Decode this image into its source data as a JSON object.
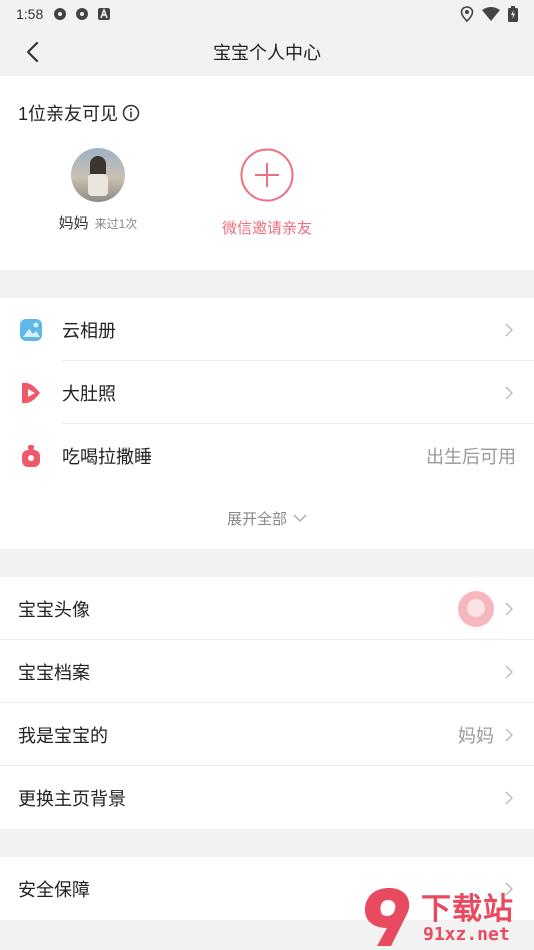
{
  "status_bar": {
    "time": "1:58"
  },
  "nav": {
    "title": "宝宝个人中心"
  },
  "visible": {
    "title": "1位亲友可见",
    "member": {
      "name": "妈妈",
      "visit": "来过1次"
    },
    "invite_label": "微信邀请亲友"
  },
  "features": {
    "items": [
      {
        "label": "云相册",
        "icon": "photo-album-icon"
      },
      {
        "label": "大肚照",
        "icon": "video-play-icon"
      },
      {
        "label": "吃喝拉撒睡",
        "icon": "baby-bottle-icon",
        "value": "出生后可用"
      }
    ],
    "expand_label": "展开全部"
  },
  "settings": {
    "items": [
      {
        "label": "宝宝头像"
      },
      {
        "label": "宝宝档案"
      },
      {
        "label": "我是宝宝的",
        "value": "妈妈"
      },
      {
        "label": "更换主页背景"
      }
    ]
  },
  "security": {
    "label": "安全保障"
  },
  "watermark": {
    "text": "下载站",
    "url": "91xz.net",
    "logo_text": "9"
  },
  "colors": {
    "accent": "#ee6f80",
    "background": "#f2f2f2",
    "album_blue": "#5fb8ea",
    "pink": "#f0596a"
  }
}
